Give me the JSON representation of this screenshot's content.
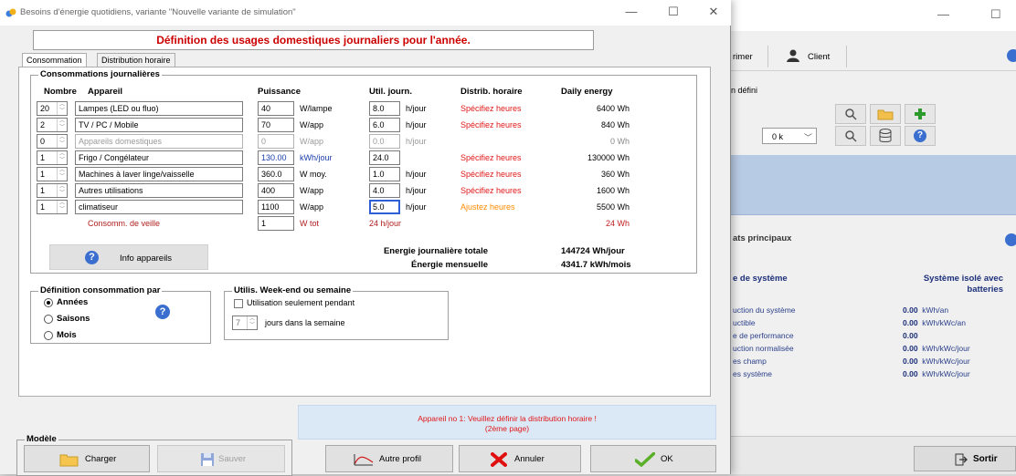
{
  "window": {
    "title": "Besoins d'énergie quotidiens, variante \"Nouvelle variante de simulation\"",
    "minimize": "—",
    "maximize": "☐",
    "close": "✕"
  },
  "banner": "Définition des usages domestiques journaliers pour l'année.",
  "tabs": [
    {
      "label": "Consommation",
      "active": true
    },
    {
      "label": "Distribution horaire",
      "active": false
    }
  ],
  "consumption": {
    "group_title": "Consommations journalières",
    "headers": {
      "nombre": "Nombre",
      "appareil": "Appareil",
      "puissance": "Puissance",
      "util": "Util. journ.",
      "distrib": "Distrib. horaire",
      "daily": "Daily energy"
    },
    "rows": [
      {
        "nombre": "20",
        "appareil": "Lampes (LED ou fluo)",
        "puissance": "40",
        "puissance_unit": "W/lampe",
        "heures": "8.0",
        "heures_unit": "h/jour",
        "distrib": "Spécifiez heures",
        "daily": "6400  Wh"
      },
      {
        "nombre": "2",
        "appareil": "TV / PC / Mobile",
        "puissance": "70",
        "puissance_unit": "W/app",
        "heures": "6.0",
        "heures_unit": "h/jour",
        "distrib": "Spécifiez heures",
        "daily": "840  Wh"
      },
      {
        "nombre": "0",
        "appareil": "Appareils domestiques",
        "puissance": "0",
        "puissance_unit": "W/app",
        "heures": "0.0",
        "heures_unit": "h/jour",
        "distrib": "",
        "daily": "0  Wh"
      },
      {
        "nombre": "1",
        "appareil": "Frigo / Congélateur",
        "puissance": "130.00",
        "puissance_unit": "kWh/jour",
        "heures": "24.0",
        "heures_unit": "",
        "distrib": "Spécifiez heures",
        "daily": "130000  Wh"
      },
      {
        "nombre": "1",
        "appareil": "Machines à laver linge/vaisselle",
        "puissance": "360.0",
        "puissance_unit": "W moy.",
        "heures": "1.0",
        "heures_unit": "h/jour",
        "distrib": "Spécifiez heures",
        "daily": "360  Wh"
      },
      {
        "nombre": "1",
        "appareil": "Autres utilisations",
        "puissance": "400",
        "puissance_unit": "W/app",
        "heures": "4.0",
        "heures_unit": "h/jour",
        "distrib": "Spécifiez heures",
        "daily": "1600  Wh"
      },
      {
        "nombre": "1",
        "appareil": "climatiseur",
        "puissance": "1100",
        "puissance_unit": "W/app",
        "heures": "5.0",
        "heures_unit": "h/jour",
        "distrib": "Ajustez heures",
        "daily": "5500  Wh"
      }
    ],
    "standby": {
      "label": "Consomm. de veille",
      "puissance": "1",
      "unit": "W tot",
      "heures": "24 h/jour",
      "daily": "24  Wh"
    },
    "info_button": "Info appareils",
    "total_daily_label": "Energie journalière totale",
    "total_daily_value": "144724  Wh/jour",
    "monthly_label": "Énergie mensuelle",
    "monthly_value": "4341.7  kWh/mois"
  },
  "definition": {
    "title": "Définition consommation par",
    "options": [
      {
        "label": "Années",
        "selected": true
      },
      {
        "label": "Saisons",
        "selected": false
      },
      {
        "label": "Mois",
        "selected": false
      }
    ]
  },
  "weekend": {
    "title": "Utilis. Week-end ou semaine",
    "checkbox_label": "Utilisation seulement pendant",
    "days_value": "7",
    "days_label": "jours dans la semaine"
  },
  "status_message": {
    "line1": "Appareil no 1: Veuillez définir la distribution horaire !",
    "line2": "(2ème page)"
  },
  "modele": {
    "title": "Modèle",
    "load": "Charger",
    "save": "Sauver"
  },
  "buttons": {
    "autre_profil": "Autre profil",
    "annuler": "Annuler",
    "ok": "OK"
  },
  "background_window": {
    "toolbar_print": "rimer",
    "toolbar_client": "Client",
    "undefined_text": "n défini",
    "combo_value": "0 k",
    "results_title": "ats principaux",
    "system_type_label": "e de système",
    "system_type_value": "Système isolé avec batteries",
    "results": [
      {
        "label": "uction du système",
        "value": "0.00",
        "unit": "kWh/an"
      },
      {
        "label": "uctible",
        "value": "0.00",
        "unit": "kWh/kWc/an"
      },
      {
        "label": "e de performance",
        "value": "0.00",
        "unit": ""
      },
      {
        "label": "uction normalisée",
        "value": "0.00",
        "unit": "kWh/kWc/jour"
      },
      {
        "label": "es champ",
        "value": "0.00",
        "unit": "kWh/kWc/jour"
      },
      {
        "label": "es système",
        "value": "0.00",
        "unit": "kWh/kWc/jour"
      }
    ],
    "exit_button": "Sortir"
  },
  "colors": {
    "banner_text": "#cc0000",
    "distrib_red": "#e01818",
    "distrib_orange": "#ff8a00",
    "blue_text": "#1a3ea8",
    "status_bg": "#dbe8f6"
  }
}
